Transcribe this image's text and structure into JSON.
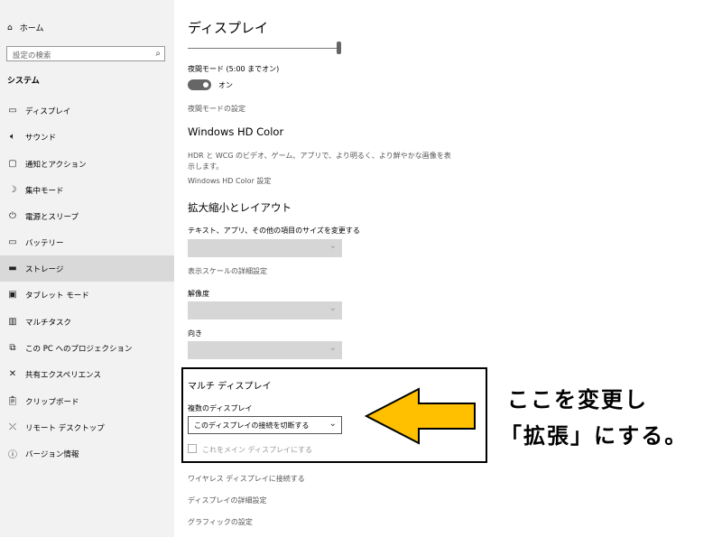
{
  "sidebar": {
    "home_label": "ホーム",
    "search_placeholder": "設定の検索",
    "section_title": "システム",
    "items": [
      {
        "label": "ディスプレイ",
        "icon": "monitor-icon"
      },
      {
        "label": "サウンド",
        "icon": "speaker-icon"
      },
      {
        "label": "通知とアクション",
        "icon": "notification-icon"
      },
      {
        "label": "集中モード",
        "icon": "moon-icon"
      },
      {
        "label": "電源とスリープ",
        "icon": "power-icon"
      },
      {
        "label": "バッテリー",
        "icon": "battery-icon"
      },
      {
        "label": "ストレージ",
        "icon": "storage-icon"
      },
      {
        "label": "タブレット モード",
        "icon": "tablet-icon"
      },
      {
        "label": "マルチタスク",
        "icon": "multitask-icon"
      },
      {
        "label": "この PC へのプロジェクション",
        "icon": "projection-icon"
      },
      {
        "label": "共有エクスペリエンス",
        "icon": "shared-icon"
      },
      {
        "label": "クリップボード",
        "icon": "clipboard-icon"
      },
      {
        "label": "リモート デスクトップ",
        "icon": "remote-icon"
      },
      {
        "label": "バージョン情報",
        "icon": "info-icon"
      }
    ],
    "selected_index": 6
  },
  "main": {
    "title": "ディスプレイ",
    "brightness": 1.0,
    "night_light_label": "夜間モード (5:00 までオン)",
    "night_toggle_state": "オン",
    "night_settings_link": "夜間モードの設定",
    "hdr_title": "Windows HD Color",
    "hdr_desc_1": "HDR と WCG のビデオ、ゲーム、アプリで、より明るく、より鮮やかな画像を表",
    "hdr_desc_2": "示します。",
    "hdr_link": "Windows HD Color 設定",
    "scale_title": "拡大縮小とレイアウト",
    "scale_label": "テキスト、アプリ、その他の項目のサイズを変更する",
    "scale_advanced_link": "表示スケールの詳細設定",
    "resolution_label": "解像度",
    "orientation_label": "向き",
    "multi_title": "マルチ ディスプレイ",
    "multi_label": "複数のディスプレイ",
    "multi_value": "このディスプレイの接続を切断する",
    "main_display_checkbox": "これをメイン ディスプレイにする",
    "wireless_link": "ワイヤレス ディスプレイに接続する",
    "advanced_link": "ディスプレイの詳細設定",
    "graphics_link": "グラフィックの設定"
  },
  "annotation": {
    "line1": "ここを変更し",
    "line2": "「拡張」にする。",
    "arrow_color": "#ffc000"
  }
}
